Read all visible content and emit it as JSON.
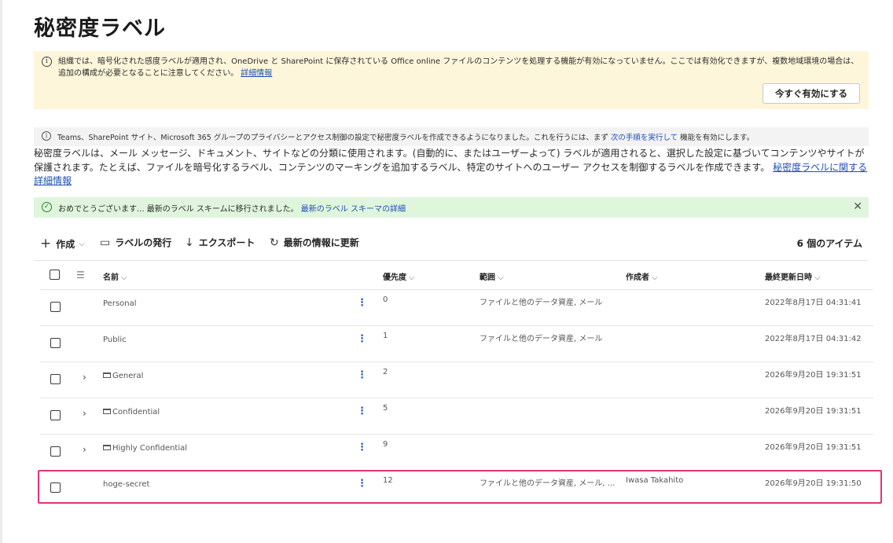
{
  "title": "秘密度ラベル",
  "warning_banner": {
    "text": "組織では、暗号化された感度ラベルが適用され、OneDrive と SharePoint に保存されている Office online ファイルのコンテンツを処理する機能が有効になっていません。ここでは有効化できますが、複数地域環境の場合は、追加の構成が必要となることに注意してください。",
    "link": "詳細情報",
    "button": "今すぐ有効にする"
  },
  "info_banner": {
    "text_before": "Teams、SharePoint サイト、Microsoft 365 グループのプライバシーとアクセス制御の設定で秘密度ラベルを作成できるようになりました。これを行うには、まず",
    "link": "次の手順を実行して",
    "text_after": "機能を有効にします。"
  },
  "description": {
    "text": "秘密度ラベルは、メール メッセージ、ドキュメント、サイトなどの分類に使用されます。(自動的に、またはユーザーよって) ラベルが適用されると、選択した設定に基づいてコンテンツやサイトが保護されます。たとえば、ファイルを暗号化するラベル、コンテンツのマーキングを追加するラベル、特定のサイトへのユーザー アクセスを制御するラベルを作成できます。",
    "link": "秘密度ラベルに関する詳細情報"
  },
  "success_banner": {
    "text": "おめでとうございます... 最新のラベル スキームに移行されました。",
    "link": "最新のラベル スキーマの詳細"
  },
  "toolbar": {
    "create": "作成",
    "publish": "ラベルの発行",
    "export": "エクスポート",
    "refresh": "最新の情報に更新",
    "item_count": "6 個のアイテム"
  },
  "columns": {
    "name": "名前",
    "priority": "優先度",
    "scope": "範囲",
    "author": "作成者",
    "modified": "最終更新日時"
  },
  "rows": [
    {
      "name": "Personal",
      "priority": "0",
      "scope": "ファイルと他のデータ資産, メール",
      "author": "",
      "modified": "2022年8月17日 04:31:41"
    },
    {
      "name": "Public",
      "priority": "1",
      "scope": "ファイルと他のデータ資産, メール",
      "author": "",
      "modified": "2022年8月17日 04:31:42"
    },
    {
      "name": "General",
      "priority": "2",
      "scope": "",
      "author": "",
      "modified": "2026年9月20日 19:31:51"
    },
    {
      "name": "Confidential",
      "priority": "5",
      "scope": "",
      "author": "",
      "modified": "2026年9月20日 19:31:51"
    },
    {
      "name": "Highly Confidential",
      "priority": "9",
      "scope": "",
      "author": "",
      "modified": "2026年9月20日 19:31:51"
    },
    {
      "name": "hoge-secret",
      "priority": "12",
      "scope": "ファイルと他のデータ資産, メール, ...",
      "author": "Iwasa Takahito",
      "modified": "2026年9月20日 19:31:50"
    }
  ],
  "colors": {
    "warning_bg": "#fdf6da",
    "success_bg": "#dff6dd",
    "link": "#1f4fb5",
    "highlight": "#e0347a"
  }
}
